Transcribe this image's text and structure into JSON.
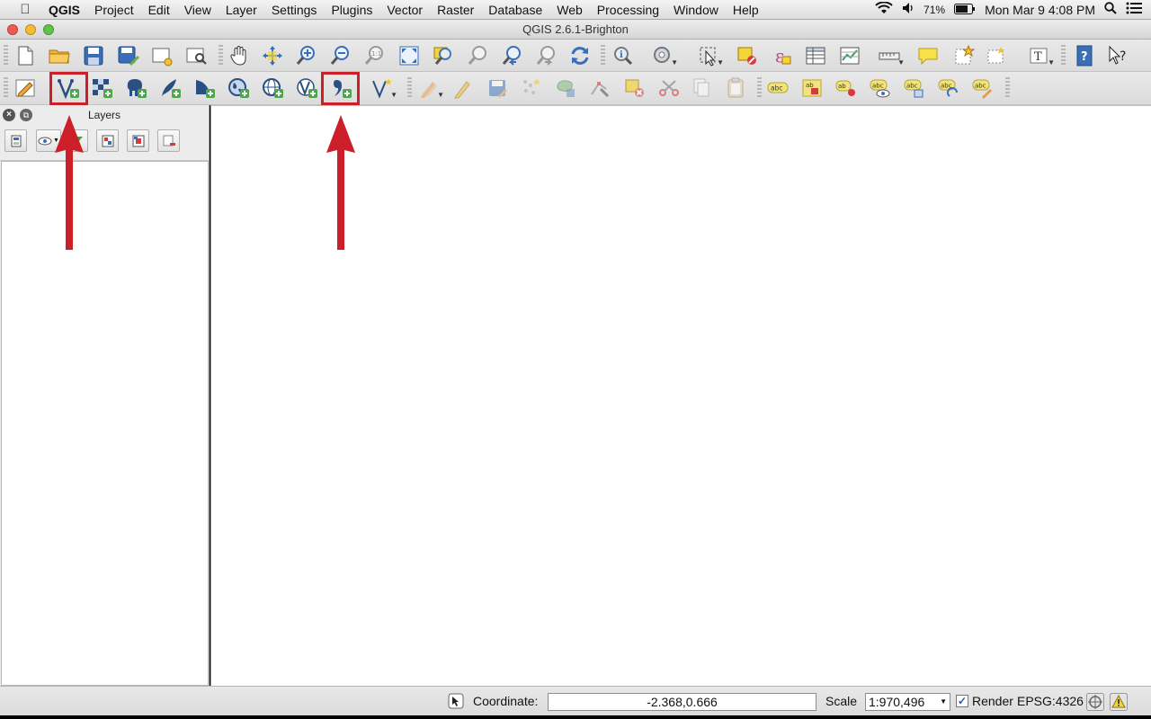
{
  "menubar": {
    "apple": "",
    "items": [
      "QGIS",
      "Project",
      "Edit",
      "View",
      "Layer",
      "Settings",
      "Plugins",
      "Vector",
      "Raster",
      "Database",
      "Web",
      "Processing",
      "Window",
      "Help"
    ],
    "battery": "71%",
    "datetime": "Mon Mar 9  4:08 PM"
  },
  "window": {
    "title": "QGIS 2.6.1-Brighton"
  },
  "layers_panel": {
    "title": "Layers"
  },
  "statusbar": {
    "coordinate_label": "Coordinate:",
    "coordinate_value": "-2.368,0.666",
    "scale_label": "Scale",
    "scale_value": "1:970,496",
    "render_label": "Render",
    "render_checked": true,
    "crs": "EPSG:4326"
  },
  "colors": {
    "highlight": "#cc1f2a",
    "accent_blue": "#1b5fb5"
  },
  "toolbar1": [
    "new-project",
    "open-project",
    "save-project",
    "save-as",
    "new-composer",
    "composer-manager",
    "pan",
    "pan-to-selection",
    "zoom-in",
    "zoom-out",
    "zoom-native",
    "zoom-full",
    "zoom-to-layer",
    "zoom-to-selection",
    "zoom-last",
    "zoom-next",
    "refresh",
    "identify",
    "action",
    "select",
    "deselect",
    "expression-select",
    "attribute-table",
    "statistics",
    "measure",
    "map-tips",
    "new-bookmark",
    "show-bookmarks",
    "text-annotation",
    "whats-this-help",
    "help"
  ],
  "toolbar2": [
    "digitize-toggle",
    "add-vector-layer",
    "add-raster-layer",
    "add-postgis-layer",
    "add-spatialite-layer",
    "add-mssql-layer",
    "add-wms-layer",
    "add-wcs-layer",
    "add-wfs-layer",
    "add-delimited-text-layer",
    "new-layer",
    "edits",
    "toggle-editing",
    "save-edits",
    "add-feature",
    "move-feature",
    "node-tool",
    "delete-selected",
    "cut",
    "copy",
    "paste",
    "label-tools"
  ]
}
